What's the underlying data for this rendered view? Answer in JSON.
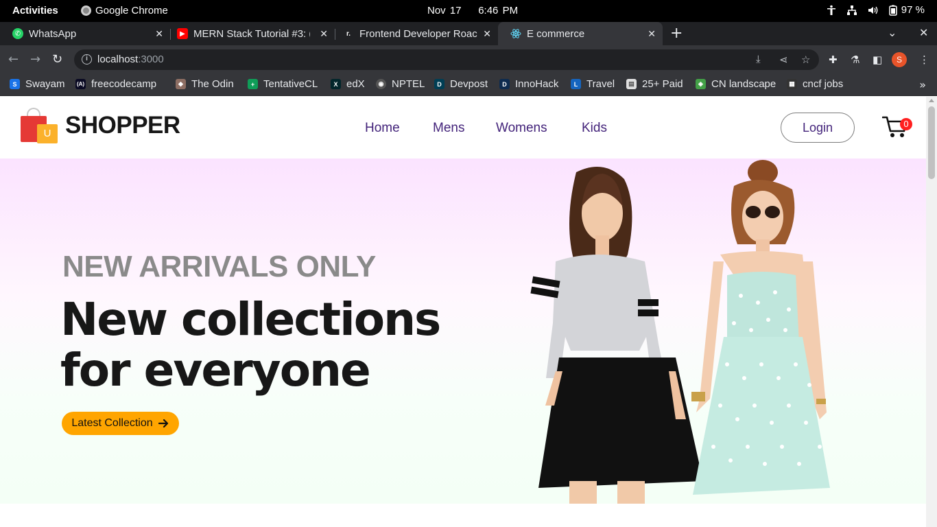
{
  "system": {
    "activities": "Activities",
    "app_name": "Google Chrome",
    "date": "Nov 17",
    "time": "6:46 PM",
    "battery": "97 %"
  },
  "tabs": [
    {
      "title": "WhatsApp",
      "icon": "whatsapp-icon",
      "color": "#25d366"
    },
    {
      "title": "MERN Stack Tutorial #3: (",
      "icon": "youtube-icon",
      "color": "#ff0000"
    },
    {
      "title": "Frontend Developer Roac",
      "icon": "roadmap-icon",
      "color": "#202124"
    },
    {
      "title": "E commerce",
      "icon": "react-icon",
      "color": "#61dafb",
      "active": true
    }
  ],
  "omnibox": {
    "host": "localhost",
    "port": ":3000"
  },
  "profile_initial": "S",
  "bookmarks": [
    {
      "label": "Swayam",
      "color": "#1a73e8",
      "glyph": "S"
    },
    {
      "label": "freecodecamp",
      "color": "#0a0a23",
      "glyph": "(A)"
    },
    {
      "label": "The Odin",
      "color": "#8d6e63",
      "glyph": "◆"
    },
    {
      "label": "TentativeCL",
      "color": "#0f9d58",
      "glyph": "+"
    },
    {
      "label": "edX",
      "color": "#02262b",
      "glyph": "X"
    },
    {
      "label": "NPTEL",
      "color": "#555555",
      "glyph": "◉"
    },
    {
      "label": "Devpost",
      "color": "#003e54",
      "glyph": "D"
    },
    {
      "label": "InnoHack",
      "color": "#0d2b4f",
      "glyph": "D"
    },
    {
      "label": "Travel",
      "color": "#1565c0",
      "glyph": "L"
    },
    {
      "label": "25+ Paid",
      "color": "#e0e0e0",
      "glyph": "▤"
    },
    {
      "label": "CN landscape",
      "color": "#43a047",
      "glyph": "◈"
    },
    {
      "label": "cncf jobs",
      "color": "#333333",
      "glyph": "▦"
    }
  ],
  "site": {
    "brand": "SHOPPER",
    "logo_letter": "U",
    "menu": [
      "Home",
      "Mens",
      "Womens",
      "Kids"
    ],
    "login_label": "Login",
    "cart_count": "0",
    "colors": {
      "accent": "#ffa500",
      "menu_text": "#43237a",
      "cart_badge": "#ff1f1f",
      "hero_top": "#fbe3ff",
      "hero_bottom": "#f4fff6"
    }
  },
  "hero": {
    "eyebrow": "NEW ARRIVALS ONLY",
    "headline_line1": "New collections",
    "headline_line2": "for everyone",
    "cta_label": "Latest Collection"
  }
}
